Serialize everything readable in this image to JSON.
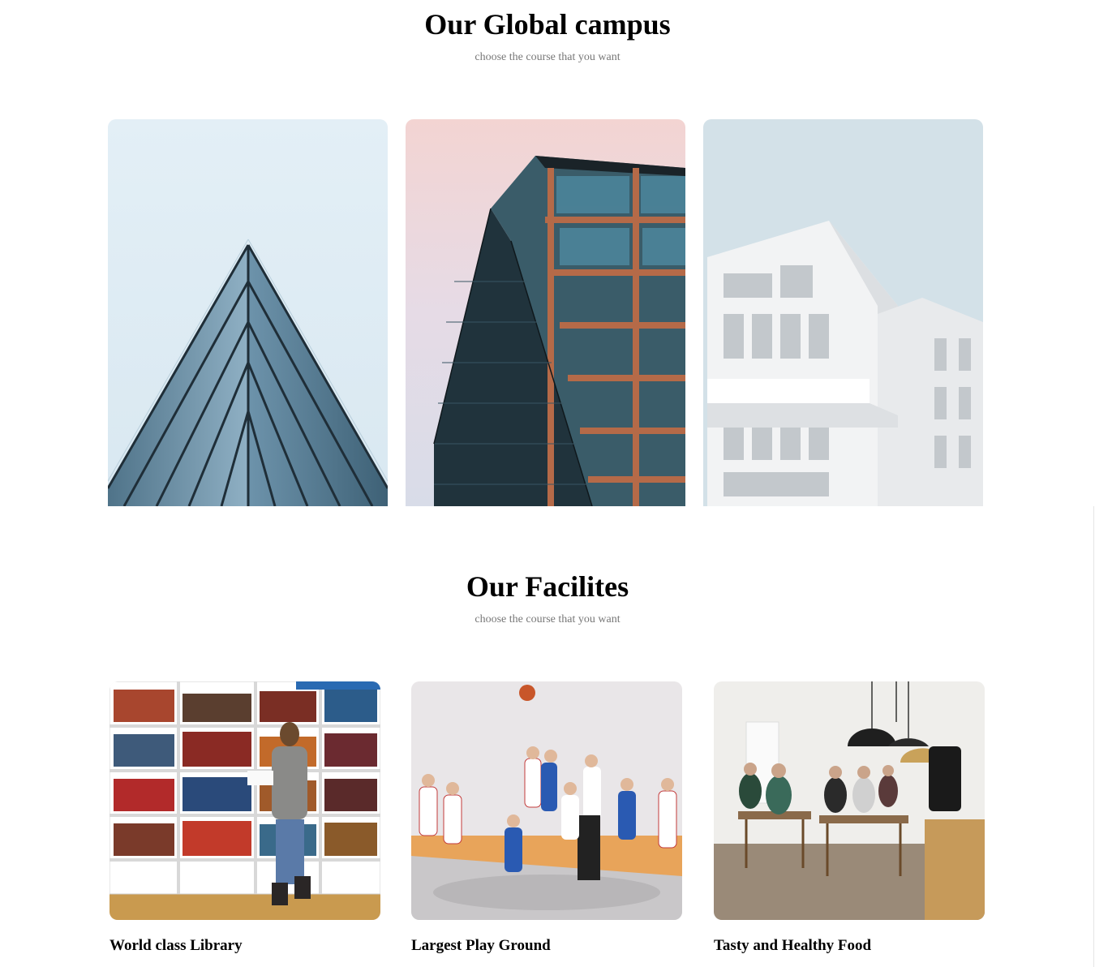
{
  "campus": {
    "title": "Our Global campus",
    "subtitle": "choose the course that you want",
    "images": [
      {
        "alt": "pyramid glass building"
      },
      {
        "alt": "copper framed glass tower"
      },
      {
        "alt": "white modular building"
      }
    ]
  },
  "facilities": {
    "title": "Our Facilites",
    "subtitle": "choose the course that you want",
    "items": [
      {
        "label": "World class Library"
      },
      {
        "label": "Largest Play Ground"
      },
      {
        "label": "Tasty and Healthy Food"
      }
    ]
  }
}
